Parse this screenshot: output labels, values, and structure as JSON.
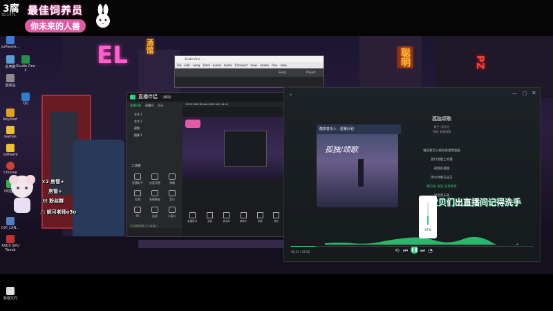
{
  "overlay": {
    "top_left_logo": "3腐",
    "top_left_small": "30.1475",
    "banner_line1": "最佳饲养员",
    "banner_line2": "你未来的人兽"
  },
  "desktop_icons": [
    {
      "label": "software...",
      "color": "#3b7dd8"
    },
    {
      "label": "Studio One 4",
      "color": "#2a8f4a"
    },
    {
      "label": "此电脑",
      "color": "#5a9fd4"
    },
    {
      "label": "回收站",
      "color": "#8c8c8c"
    },
    {
      "label": "QQ",
      "color": "#2d7fd3"
    },
    {
      "label": "KeyShot",
      "color": "#e0a020"
    },
    {
      "label": "Games",
      "color": "#f0c030"
    },
    {
      "label": "software",
      "color": "#f0c030"
    },
    {
      "label": "Chrome",
      "color": "#d04030"
    },
    {
      "label": "QQ音乐",
      "color": "#30b050"
    },
    {
      "label": "DXI_LAN...",
      "color": "#5080c0"
    },
    {
      "label": "ASUS GPU Tweak",
      "color": "#c03030"
    },
    {
      "label": "新建文件",
      "color": "#dddddd"
    }
  ],
  "neon_signs": [
    "酒",
    "馆",
    "聪",
    "明",
    "P",
    "Z"
  ],
  "daw": {
    "title": "Studio One - ...",
    "menu": "File Edit Song Track Event Audio Transport View Studio One Help",
    "song_label": "Song",
    "project_label": "Project"
  },
  "live_app": {
    "title": "直播伴侣",
    "version": "V2.5",
    "nav_tabs": [
      "直播场景",
      "直播间",
      "互动"
    ],
    "scene_items": [
      "文本 1",
      "文本 2",
      "视频",
      "图像 1"
    ],
    "tools_label": "工具箱",
    "tools": [
      "直播助手",
      "房管设置",
      "弹幕",
      "礼物",
      "直播数据",
      "音乐",
      "PK",
      "连麦",
      "小窗口",
      "抽奖",
      "更多功能",
      "美颜"
    ],
    "preview_header": "1920*1080 Bitrate:5000 AAC 44.1K",
    "bottom_buttons": [
      "直播推流",
      "画面",
      "麦克风",
      "摄像头",
      "录屏",
      "音效"
    ],
    "footer_text": "已连接服务器 正在直播中"
  },
  "player": {
    "song_title": "孤独颂歌",
    "album_header": "酷狗音乐人 · 星耀计划",
    "cover_text": "孤独/颂歌",
    "meta": [
      "歌手: 阿亦伦",
      "专辑: 孤独颂歌"
    ],
    "lyrics": [
      "谁说我可以被轻易复制粘贴",
      "旅行地图上的我",
      "夜晚的孤独",
      "所以你要去远方",
      "我只会 哭泣 天荒地老",
      "流浪到天涯"
    ],
    "time_current": "00:21 / 03:58",
    "volume_pct": "37%",
    "subtitle": "宝贝们出直播间记得洗手"
  },
  "streamer_overlay": {
    "chat_lines": [
      "×2 房管+",
      "房管+",
      "tt 粉丝群",
      "♪: 妮可老师o3o"
    ]
  },
  "colors": {
    "accent_green": "#2ed27a",
    "neon_pink": "#e040a0",
    "player_bg": "#1b2024"
  }
}
